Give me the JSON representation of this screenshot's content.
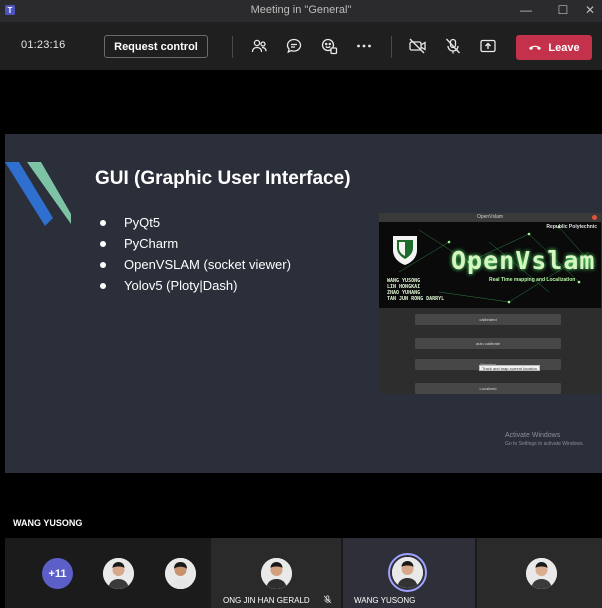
{
  "window": {
    "title": "Meeting in \"General\"",
    "minimize_glyph": "—",
    "maximize_glyph": "☐",
    "close_glyph": "✕"
  },
  "toolbar": {
    "timer": "01:23:16",
    "request_control_label": "Request control",
    "icons": [
      "people-icon",
      "chat-icon",
      "reactions-icon",
      "more-icon",
      "camera-off-icon",
      "mic-off-icon",
      "share-icon"
    ],
    "leave_label": "Leave",
    "leave_color": "#c4314b"
  },
  "slide": {
    "title": "GUI (Graphic User Interface)",
    "bullets": [
      "PyQt5",
      "PyCharm",
      "OpenVSLAM (socket viewer)",
      "Yolov5 (Ploty|Dash)"
    ],
    "background_color": "#2a2f3a",
    "activate_line1": "Activate Windows",
    "activate_line2": "Go to Settings to activate Windows.",
    "inset": {
      "window_title": "OpenVslam",
      "school": "Republic Polytechnic",
      "brand": "OpenVslam",
      "tagline": "Real Time mapping and Localization",
      "names": [
        "WANG YUSONG",
        "LIN HONGKAI",
        "ZHAO YUHANG",
        "TAN JUN RONG DARRYL"
      ],
      "buttons": [
        "calibrated",
        "auto calibrate",
        "Mapping",
        "Localized"
      ],
      "tooltip": "Track and map current location"
    }
  },
  "speaker": {
    "name": "WANG YUSONG"
  },
  "gallery": {
    "overflow_count": "+11",
    "participants": [
      {
        "name": ""
      },
      {
        "name": ""
      },
      {
        "name": "ONG JIN HAN GERALD",
        "muted": true
      },
      {
        "name": "WANG YUSONG",
        "speaking": true
      },
      {
        "name": ""
      }
    ],
    "accent_color": "#5b5fc7"
  }
}
